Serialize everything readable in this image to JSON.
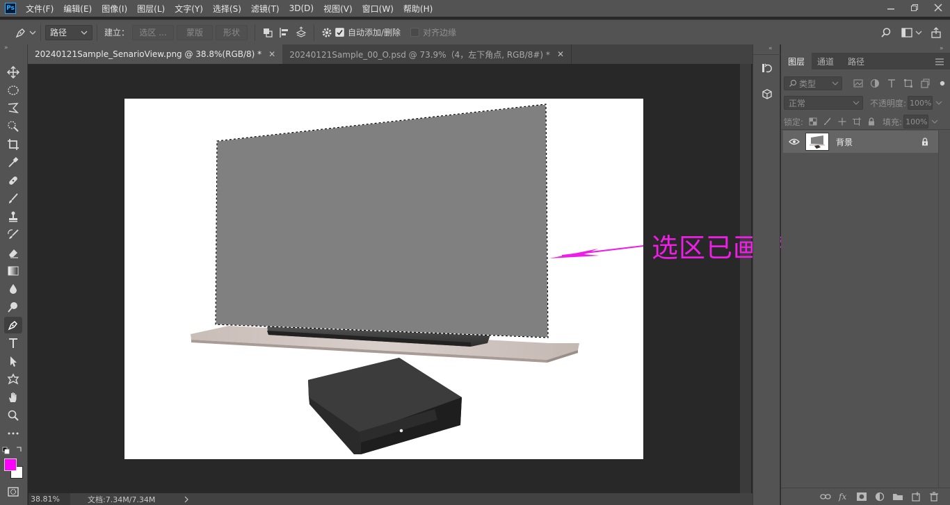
{
  "app": {
    "logo": "Ps"
  },
  "menu": [
    "文件(F)",
    "编辑(E)",
    "图像(I)",
    "图层(L)",
    "文字(Y)",
    "选择(S)",
    "滤镜(T)",
    "3D(D)",
    "视图(V)",
    "窗口(W)",
    "帮助(H)"
  ],
  "options_bar": {
    "mode_value": "路径",
    "make_label": "建立：",
    "selection_button": "选区 ...",
    "mask_button": "蒙版",
    "shape_button": "形状",
    "auto_add_delete_label": "自动添加/删除",
    "auto_add_delete_checked": true,
    "align_edges_label": "对齐边缘",
    "align_edges_checked": false
  },
  "tabs": [
    {
      "label": "20240121Sample_SenarioView.png @ 38.8%(RGB/8) *",
      "active": true
    },
    {
      "label": "20240121Sample_00_O.psd  @  73.9%（4，左下角点, RGB/8#) *",
      "active": false
    }
  ],
  "status": {
    "zoom": "38.81%",
    "doc_size": "文档:7.34M/7.34M"
  },
  "annotation": {
    "text": "选区已画好",
    "color": "#ee1ee6"
  },
  "colors": {
    "foreground": "#ff00ff",
    "background": "#ffffff",
    "ui_panel": "#535353",
    "canvas_bg": "#282828"
  },
  "layers_panel": {
    "tabs": [
      "图层",
      "通道",
      "路径"
    ],
    "filter_placeholder": "类型",
    "blend_mode": "正常",
    "opacity_label": "不透明度:",
    "opacity_value": "100%",
    "lock_label": "锁定:",
    "fill_label": "填充:",
    "fill_value": "100%",
    "layers": [
      {
        "name": "背景",
        "visible": true,
        "locked": true
      }
    ]
  },
  "tools": [
    "move-tool",
    "marquee-tool",
    "lasso-tool",
    "quick-select-tool",
    "crop-tool",
    "eyedropper-tool",
    "healing-brush-tool",
    "brush-tool",
    "clone-stamp-tool",
    "history-brush-tool",
    "eraser-tool",
    "gradient-tool",
    "blur-tool",
    "dodge-tool",
    "pen-tool",
    "type-tool",
    "path-select-tool",
    "custom-shape-tool",
    "hand-tool",
    "zoom-tool",
    "more-tools"
  ]
}
